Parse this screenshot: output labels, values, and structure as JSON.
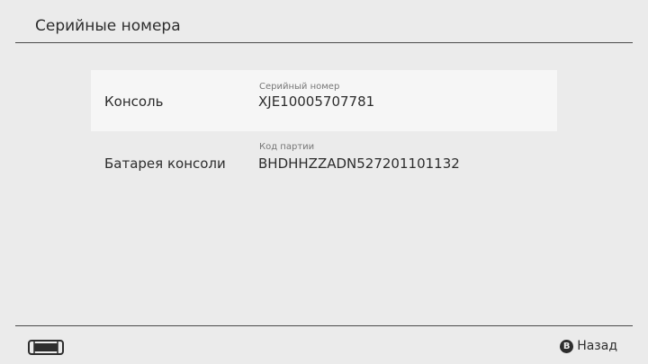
{
  "header": {
    "title": "Серийные номера"
  },
  "serials": [
    {
      "label": "Консоль",
      "caption": "Серийный номер",
      "value": "XJE10005707781"
    },
    {
      "label": "Батарея консоли",
      "caption": "Код партии",
      "value": "BHDHHZZADN527201101132"
    }
  ],
  "footer": {
    "device_icon": "handheld-console-icon",
    "back_icon_glyph": "B",
    "back_label": "Назад"
  }
}
